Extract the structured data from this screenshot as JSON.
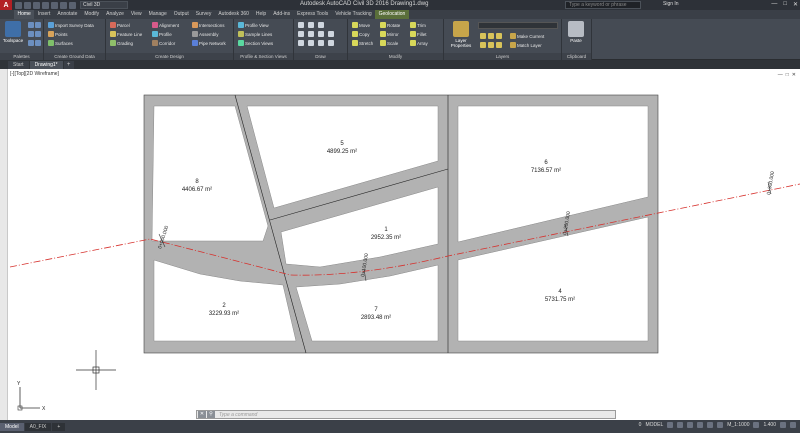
{
  "app": {
    "logo": "A",
    "workspace": "Civil 3D",
    "title": "Autodesk AutoCAD Civil 3D 2016    Drawing1.dwg",
    "search_placeholder": "Type a keyword or phrase",
    "sign_in": "Sign In",
    "window_controls": [
      "—",
      "□",
      "✕"
    ]
  },
  "ribbon_tabs": [
    "Home",
    "Insert",
    "Annotate",
    "Modify",
    "Analyze",
    "View",
    "Manage",
    "Output",
    "Survey",
    "Autodesk 360",
    "Help",
    "Add-ins",
    "Express Tools",
    "Vehicle Tracking",
    "Geolocation"
  ],
  "active_tab": "Home",
  "context_tab": "Geolocation",
  "ribbon": {
    "toolspace": "Toolspace",
    "palettes": "Palettes",
    "ground_data": [
      "Import Survey Data",
      "Points",
      "Surfaces"
    ],
    "ground_label": "Create Ground Data",
    "design_col1": [
      "Parcel",
      "Feature Line",
      "Grading"
    ],
    "design_col2": [
      "Alignment",
      "Profile",
      "Corridor"
    ],
    "design_col3": [
      "Intersections",
      "Assembly",
      "Pipe Network"
    ],
    "design_label": "Create Design",
    "profile_items": [
      "Profile View",
      "Sample Lines",
      "Section Views"
    ],
    "profile_label": "Profile & Section Views",
    "draw_label": "Draw",
    "modify_col1": [
      "Move",
      "Copy",
      "Stretch"
    ],
    "modify_col2": [
      "Rotate",
      "Mirror",
      "Scale"
    ],
    "modify_col3": [
      "Trim",
      "Fillet",
      "Array"
    ],
    "modify_label": "Modify",
    "layer_props": "Layer Properties",
    "layer_items": [
      "Make Current",
      "Match Layer"
    ],
    "layers_label": "Layers",
    "paste": "Paste",
    "clipboard_label": "Clipboard"
  },
  "file_tabs": [
    "Start",
    "Drawing1*"
  ],
  "active_file": "Drawing1*",
  "canvas": {
    "viewport_label": "[-][Top][2D Wireframe]",
    "controls": [
      "—",
      "□",
      "✕"
    ]
  },
  "parcels": [
    {
      "id": "8",
      "area": "4406.67 m²"
    },
    {
      "id": "5",
      "area": "4899.25 m²"
    },
    {
      "id": "6",
      "area": "7136.57 m²"
    },
    {
      "id": "1",
      "area": "2952.35 m²"
    },
    {
      "id": "2",
      "area": "3229.93 m²"
    },
    {
      "id": "7",
      "area": "2893.48 m²"
    },
    {
      "id": "4",
      "area": "5731.75 m²"
    }
  ],
  "stations": [
    "0+000.000",
    "0+100.000",
    "0+200.000",
    "0+300.000"
  ],
  "ucs": {
    "x": "X",
    "y": "Y"
  },
  "command": {
    "buttons": [
      "✕",
      "⚲"
    ],
    "placeholder": "Type a command"
  },
  "layout_tabs": [
    "Model",
    "A0_FIX"
  ],
  "status": {
    "coords": "0",
    "model": "MODEL",
    "scale": "M_1:1000",
    "zoom": "1.400"
  }
}
